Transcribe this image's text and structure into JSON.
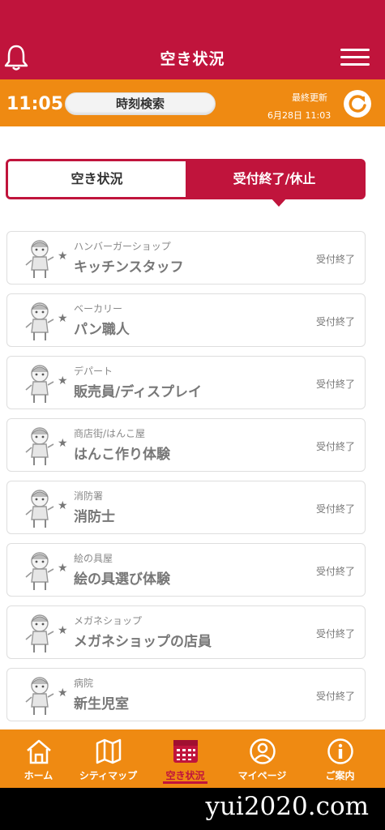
{
  "header": {
    "title": "空き状況"
  },
  "timebar": {
    "clock": "11:05",
    "search_label": "時刻検索",
    "updated_label": "最終更新",
    "updated_value": "6月28日 11:03"
  },
  "tabs": {
    "left": "空き状況",
    "right": "受付終了/休止",
    "active": "right"
  },
  "items": [
    {
      "category": "ハンバーガーショップ",
      "job": "キッチンスタッフ",
      "status": "受付終了"
    },
    {
      "category": "ベーカリー",
      "job": "パン職人",
      "status": "受付終了"
    },
    {
      "category": "デパート",
      "job": "販売員/ディスプレイ",
      "status": "受付終了"
    },
    {
      "category": "商店街/はんこ屋",
      "job": "はんこ作り体験",
      "status": "受付終了"
    },
    {
      "category": "消防署",
      "job": "消防士",
      "status": "受付終了"
    },
    {
      "category": "絵の具屋",
      "job": "絵の具選び体験",
      "status": "受付終了"
    },
    {
      "category": "メガネショップ",
      "job": "メガネショップの店員",
      "status": "受付終了"
    },
    {
      "category": "病院",
      "job": "新生児室",
      "status": "受付終了"
    }
  ],
  "nav": {
    "home": "ホーム",
    "citymap": "シティマップ",
    "availability": "空き状況",
    "mypage": "マイページ",
    "info": "ご案内",
    "active": "availability"
  },
  "watermark": "yui2020.com",
  "colors": {
    "brand_red": "#c0143c",
    "brand_orange": "#ef8a12"
  }
}
